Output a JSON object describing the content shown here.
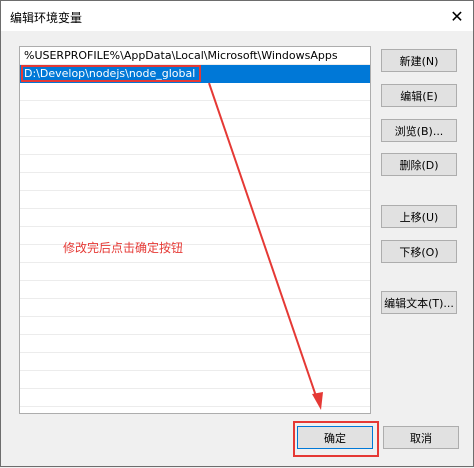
{
  "window": {
    "title": "编辑环境变量",
    "close_glyph": "✕"
  },
  "list": {
    "items": [
      "%USERPROFILE%\\AppData\\Local\\Microsoft\\WindowsApps",
      "D:\\Develop\\nodejs\\node_global"
    ],
    "selected_index": 1
  },
  "buttons": {
    "new": "新建(N)",
    "edit": "编辑(E)",
    "browse": "浏览(B)...",
    "delete": "删除(D)",
    "move_up": "上移(U)",
    "move_down": "下移(O)",
    "edit_text": "编辑文本(T)...",
    "ok": "确定",
    "cancel": "取消"
  },
  "annotation": {
    "text": "修改完后点击确定按钮",
    "color": "#e53935"
  },
  "colors": {
    "selection": "#0078d7",
    "dialog_bg": "#f0f0f0"
  }
}
